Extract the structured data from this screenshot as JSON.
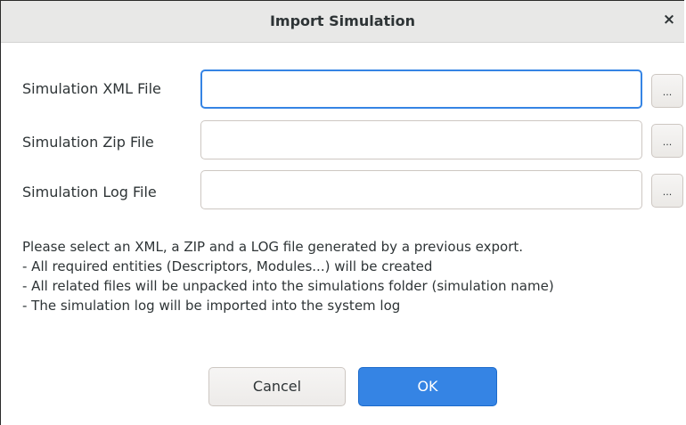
{
  "dialog": {
    "title": "Import Simulation",
    "close_glyph": "×"
  },
  "fields": [
    {
      "label": "Simulation XML File",
      "value": "",
      "browse_label": "..."
    },
    {
      "label": "Simulation Zip File",
      "value": "",
      "browse_label": "..."
    },
    {
      "label": "Simulation Log File",
      "value": "",
      "browse_label": "..."
    }
  ],
  "info": {
    "lines": [
      "Please select an XML, a ZIP and a LOG file generated by a previous export.",
      "- All required entities (Descriptors, Modules...) will be created",
      "- All related files will be unpacked into the simulations folder (simulation name)",
      "- The simulation log will be imported into the system log"
    ]
  },
  "buttons": {
    "cancel_label": "Cancel",
    "ok_label": "OK"
  },
  "colors": {
    "accent": "#3584e4",
    "titlebar": "#e8e8e7",
    "text": "#2e3436"
  }
}
